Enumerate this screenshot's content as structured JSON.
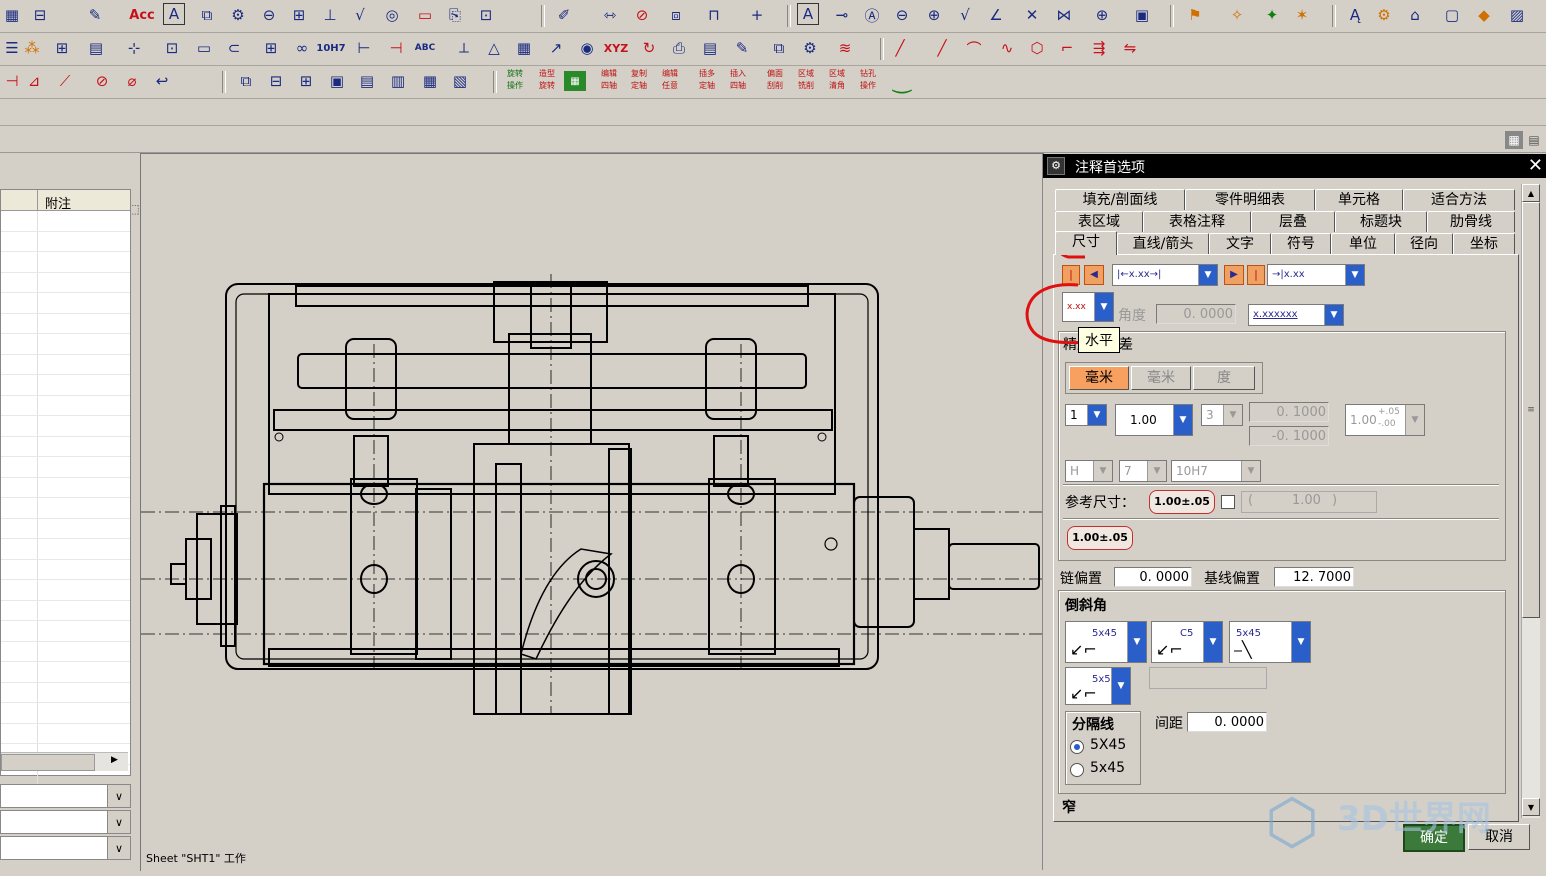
{
  "toolbar": {
    "row3_cn_buttons": [
      "旋转\n操作",
      "造型\n旋转",
      "编辑\n四轴",
      "复制\n定轴",
      "编辑\n任意",
      "插多\n定轴",
      "插入\n四轴",
      "偏面\n刮削",
      "区域\n铣削",
      "区域\n清角",
      "钻孔\n操作"
    ],
    "icon_labels": {
      "acc": "Acc",
      "a_text": "A",
      "tenh7": "10H7",
      "abc": "ABC",
      "xyz": "XYZ"
    }
  },
  "left_panel": {
    "column_header": "附注"
  },
  "canvas": {
    "status_text": "Sheet \"SHT1\" 工作"
  },
  "dialog": {
    "title": "注释首选项",
    "tabs_row1": [
      "填充/剖面线",
      "零件明细表",
      "单元格",
      "适合方法"
    ],
    "tabs_row2": [
      "表区域",
      "表格注释",
      "层叠",
      "标题块",
      "肋骨线"
    ],
    "tabs_row3": [
      "尺寸",
      "直线/箭头",
      "文字",
      "符号",
      "单位",
      "径向",
      "坐标"
    ],
    "active_tab": "尺寸",
    "dim_style_text": "|←x.xx→|",
    "dim_style2_text": "→|x.xx",
    "angle_label": "角度",
    "angle_value": "0. 0000",
    "dim_text_style": "x.xxxxxx",
    "tooltip": "水平",
    "section_precision_label": "精度和公差",
    "unit_buttons": [
      "毫米",
      "毫米",
      "度"
    ],
    "precision_value": "1",
    "nominal_value": "1.00",
    "tol_precision": "3",
    "upper_tol": "0. 1000",
    "lower_tol": "-0. 1000",
    "tol_display": "1.00",
    "tol_upper_mark": "+.05",
    "tol_lower_mark": "-.00",
    "fit_hole": "H",
    "fit_grade": "7",
    "fit_display": "10H7",
    "ref_dim_label": "参考尺寸：",
    "ref_dim_button": "1.00±.05",
    "ref_paren_open": "(",
    "ref_paren_value": "1.00",
    "ref_paren_close": ")",
    "tol_button2": "1.00±.05",
    "chain_offset_label": "链偏置",
    "chain_offset_value": "0. 0000",
    "baseline_offset_label": "基线偏置",
    "baseline_offset_value": "12. 7000",
    "chamfer_label": "倒斜角",
    "chamfer_styles": [
      "5x45",
      "C5",
      "5x45",
      "5x5"
    ],
    "separator_label": "分隔线",
    "spacing_label": "间距",
    "spacing_value": "0. 0000",
    "separator_options": [
      "5X45",
      "5x45"
    ],
    "separator_selected": 0,
    "narrow_label": "窄",
    "ok_button": "确定",
    "cancel_button": "取消"
  },
  "watermark": "3D世界网",
  "colors": {
    "accent_blue": "#2a5ec9",
    "annotation_red": "#e01010",
    "active_orange": "#f28c4a"
  }
}
